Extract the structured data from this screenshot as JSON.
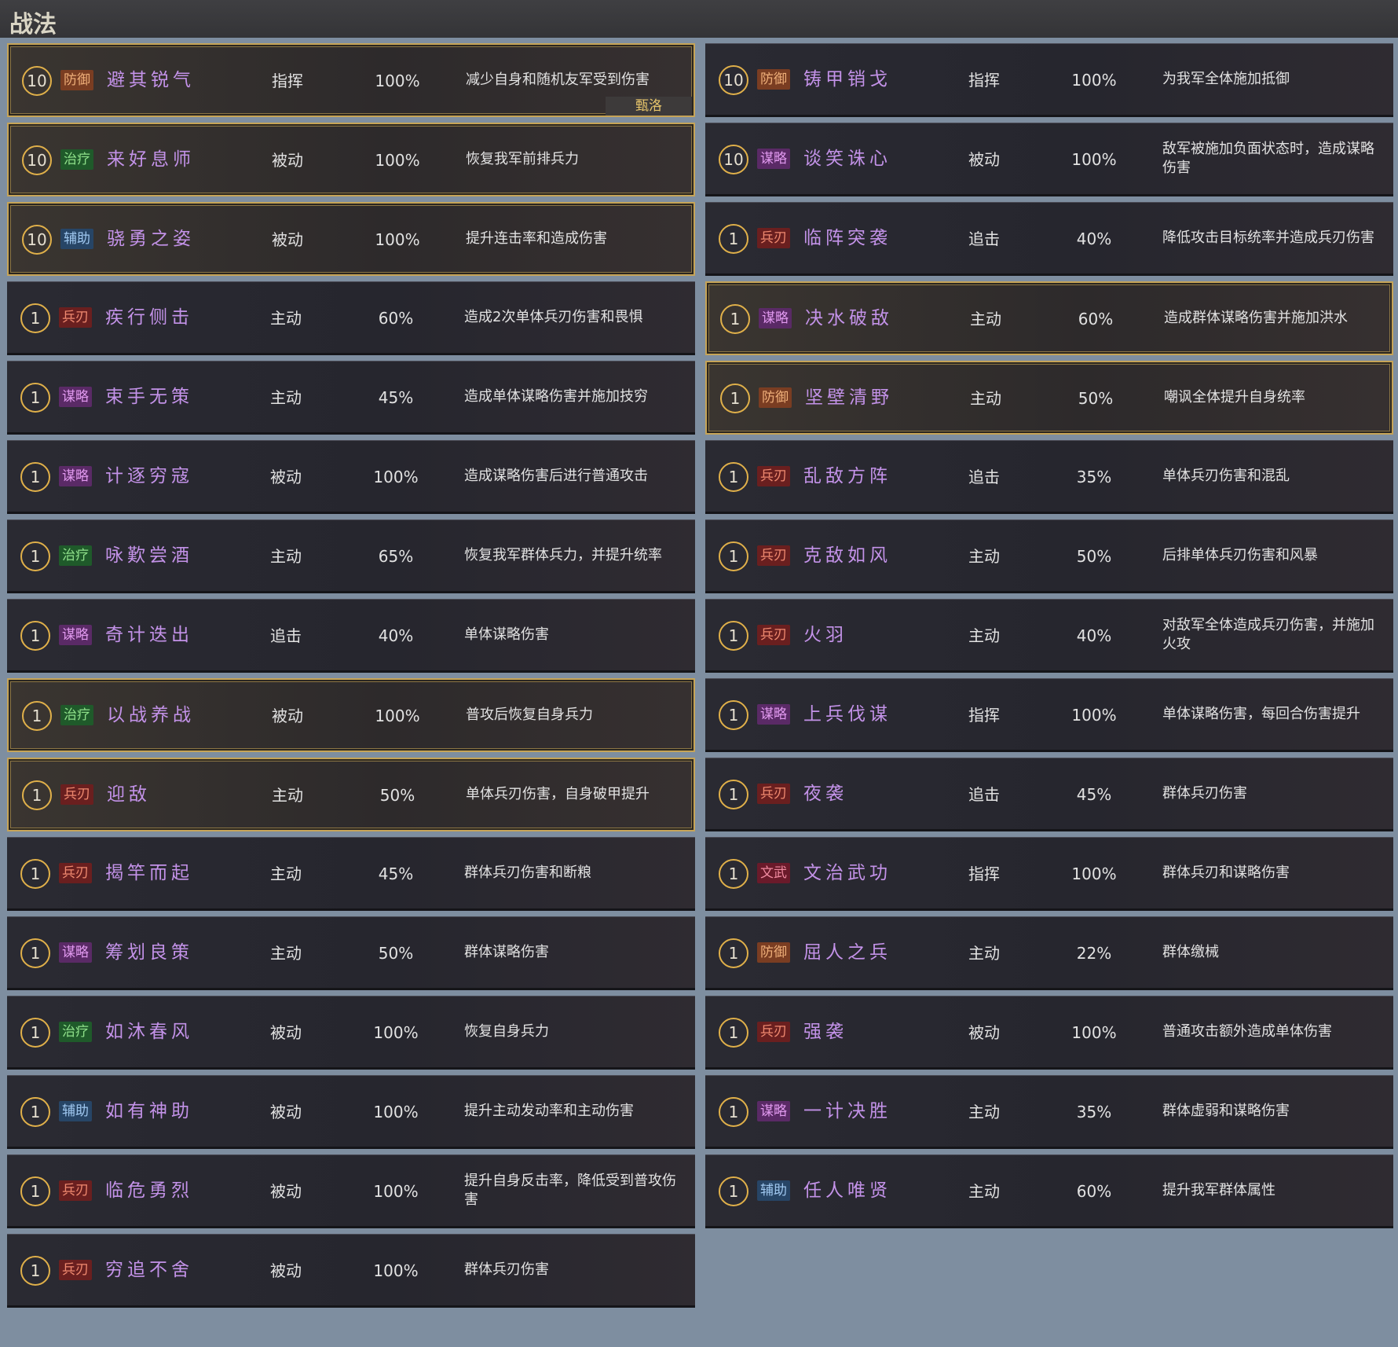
{
  "header": {
    "title": "战法"
  },
  "left": [
    {
      "level": "10",
      "tag": "防御",
      "tag_type": "def",
      "name": "避其锐气",
      "type": "指挥",
      "rate": "100%",
      "desc": "减少自身和随机友军受到伤害",
      "owner": "甄洛",
      "gold": true
    },
    {
      "level": "10",
      "tag": "治疗",
      "tag_type": "heal",
      "name": "来好息师",
      "type": "被动",
      "rate": "100%",
      "desc": "恢复我军前排兵力",
      "gold": true
    },
    {
      "level": "10",
      "tag": "辅助",
      "tag_type": "aid",
      "name": "骁勇之姿",
      "type": "被动",
      "rate": "100%",
      "desc": "提升连击率和造成伤害",
      "gold": true
    },
    {
      "level": "1",
      "tag": "兵刃",
      "tag_type": "blade",
      "name": "疾行侧击",
      "type": "主动",
      "rate": "60%",
      "desc": "造成2次单体兵刃伤害和畏惧"
    },
    {
      "level": "1",
      "tag": "谋略",
      "tag_type": "plot",
      "name": "束手无策",
      "type": "主动",
      "rate": "45%",
      "desc": "造成单体谋略伤害并施加技穷"
    },
    {
      "level": "1",
      "tag": "谋略",
      "tag_type": "plot",
      "name": "计逐穷寇",
      "type": "被动",
      "rate": "100%",
      "desc": "造成谋略伤害后进行普通攻击"
    },
    {
      "level": "1",
      "tag": "治疗",
      "tag_type": "heal",
      "name": "咏歎尝酒",
      "type": "主动",
      "rate": "65%",
      "desc": "恢复我军群体兵力，并提升统率"
    },
    {
      "level": "1",
      "tag": "谋略",
      "tag_type": "plot",
      "name": "奇计迭出",
      "type": "追击",
      "rate": "40%",
      "desc": "单体谋略伤害"
    },
    {
      "level": "1",
      "tag": "治疗",
      "tag_type": "heal",
      "name": "以战养战",
      "type": "被动",
      "rate": "100%",
      "desc": "普攻后恢复自身兵力",
      "gold": true
    },
    {
      "level": "1",
      "tag": "兵刃",
      "tag_type": "blade",
      "name": "迎敌",
      "type": "主动",
      "rate": "50%",
      "desc": "单体兵刃伤害，自身破甲提升",
      "gold": true
    },
    {
      "level": "1",
      "tag": "兵刃",
      "tag_type": "blade",
      "name": "揭竿而起",
      "type": "主动",
      "rate": "45%",
      "desc": "群体兵刃伤害和断粮"
    },
    {
      "level": "1",
      "tag": "谋略",
      "tag_type": "plot",
      "name": "筹划良策",
      "type": "主动",
      "rate": "50%",
      "desc": "群体谋略伤害"
    },
    {
      "level": "1",
      "tag": "治疗",
      "tag_type": "heal",
      "name": "如沐春风",
      "type": "被动",
      "rate": "100%",
      "desc": "恢复自身兵力"
    },
    {
      "level": "1",
      "tag": "辅助",
      "tag_type": "aid",
      "name": "如有神助",
      "type": "被动",
      "rate": "100%",
      "desc": "提升主动发动率和主动伤害"
    },
    {
      "level": "1",
      "tag": "兵刃",
      "tag_type": "blade",
      "name": "临危勇烈",
      "type": "被动",
      "rate": "100%",
      "desc": "提升自身反击率，降低受到普攻伤害"
    },
    {
      "level": "1",
      "tag": "兵刃",
      "tag_type": "blade",
      "name": "穷追不舍",
      "type": "被动",
      "rate": "100%",
      "desc": "群体兵刃伤害"
    }
  ],
  "right": [
    {
      "level": "10",
      "tag": "防御",
      "tag_type": "def",
      "name": "铸甲销戈",
      "type": "指挥",
      "rate": "100%",
      "desc": "为我军全体施加抵御"
    },
    {
      "level": "10",
      "tag": "谋略",
      "tag_type": "plot",
      "name": "谈笑诛心",
      "type": "被动",
      "rate": "100%",
      "desc": "敌军被施加负面状态时，造成谋略伤害"
    },
    {
      "level": "1",
      "tag": "兵刃",
      "tag_type": "blade",
      "name": "临阵突袭",
      "type": "追击",
      "rate": "40%",
      "desc": "降低攻击目标统率并造成兵刃伤害"
    },
    {
      "level": "1",
      "tag": "谋略",
      "tag_type": "plot",
      "name": "决水破敌",
      "type": "主动",
      "rate": "60%",
      "desc": "造成群体谋略伤害并施加洪水",
      "gold": true
    },
    {
      "level": "1",
      "tag": "防御",
      "tag_type": "def",
      "name": "坚壁清野",
      "type": "主动",
      "rate": "50%",
      "desc": "嘲讽全体提升自身统率",
      "gold": true
    },
    {
      "level": "1",
      "tag": "兵刃",
      "tag_type": "blade",
      "name": "乱敌方阵",
      "type": "追击",
      "rate": "35%",
      "desc": "单体兵刃伤害和混乱"
    },
    {
      "level": "1",
      "tag": "兵刃",
      "tag_type": "blade",
      "name": "克敌如风",
      "type": "主动",
      "rate": "50%",
      "desc": "后排单体兵刃伤害和风暴"
    },
    {
      "level": "1",
      "tag": "兵刃",
      "tag_type": "blade",
      "name": "火羽",
      "type": "主动",
      "rate": "40%",
      "desc": "对敌军全体造成兵刃伤害，并施加火攻"
    },
    {
      "level": "1",
      "tag": "谋略",
      "tag_type": "plot",
      "name": "上兵伐谋",
      "type": "指挥",
      "rate": "100%",
      "desc": "单体谋略伤害，每回合伤害提升"
    },
    {
      "level": "1",
      "tag": "兵刃",
      "tag_type": "blade",
      "name": "夜袭",
      "type": "追击",
      "rate": "45%",
      "desc": "群体兵刃伤害"
    },
    {
      "level": "1",
      "tag": "文武",
      "tag_type": "wenwu",
      "name": "文治武功",
      "type": "指挥",
      "rate": "100%",
      "desc": "群体兵刃和谋略伤害"
    },
    {
      "level": "1",
      "tag": "防御",
      "tag_type": "def",
      "name": "屈人之兵",
      "type": "主动",
      "rate": "22%",
      "desc": "群体缴械"
    },
    {
      "level": "1",
      "tag": "兵刃",
      "tag_type": "blade",
      "name": "强袭",
      "type": "被动",
      "rate": "100%",
      "desc": "普通攻击额外造成单体伤害"
    },
    {
      "level": "1",
      "tag": "谋略",
      "tag_type": "plot",
      "name": "一计决胜",
      "type": "主动",
      "rate": "35%",
      "desc": "群体虚弱和谋略伤害"
    },
    {
      "level": "1",
      "tag": "辅助",
      "tag_type": "aid",
      "name": "任人唯贤",
      "type": "主动",
      "rate": "60%",
      "desc": "提升我军群体属性"
    }
  ]
}
